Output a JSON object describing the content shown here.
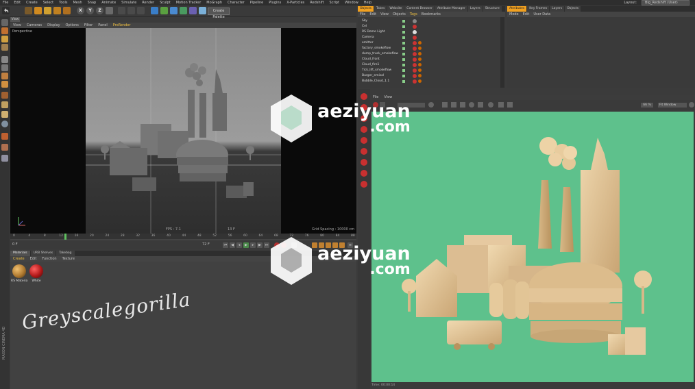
{
  "app": {
    "menu": [
      "File",
      "Edit",
      "Create",
      "Select",
      "Tools",
      "Mesh",
      "Snap",
      "Animate",
      "Simulate",
      "Render",
      "Sculpt",
      "Motion Tracker",
      "MoGraph",
      "Character",
      "Pipeline",
      "Plugins",
      "X-Particles",
      "Redshift",
      "Script",
      "Window",
      "Help"
    ],
    "layout_label": "Layout:",
    "layout_value": "Big_Redshift (User)"
  },
  "toolbar": {
    "axis_x": "X",
    "axis_y": "Y",
    "axis_z": "Z",
    "render_badge": "Create Palette"
  },
  "viewport": {
    "tab": "View",
    "menu": [
      "View",
      "Cameras",
      "Display",
      "Options",
      "Filter",
      "Panel",
      "ProRender"
    ],
    "active_menu": "ProRender",
    "label": "Perspective",
    "fps": "FPS : 7.1",
    "frame": "13 F",
    "grid_spacing": "Grid Spacing : 10000 cm"
  },
  "timeline": {
    "ticks": [
      "0",
      "4",
      "8",
      "12",
      "16",
      "20",
      "24",
      "28",
      "32",
      "36",
      "40",
      "44",
      "48",
      "52",
      "56",
      "60",
      "64",
      "68",
      "72",
      "76",
      "80",
      "84",
      "88"
    ],
    "current_frame": "13 F",
    "start": "0 F",
    "end": "72 F"
  },
  "materials": {
    "tabs": [
      "Materials",
      "URB Shelves",
      "Takebag"
    ],
    "menu": [
      "Create",
      "Edit",
      "Function",
      "Texture"
    ],
    "active_menu": "Create",
    "items": [
      {
        "name": "RS Materia",
        "color": "#c88a38"
      },
      {
        "name": "White",
        "color": "#b01818"
      }
    ]
  },
  "brand": {
    "logo_text": "Greyscalegorilla",
    "side_text": "MAXON CINEMA 4D"
  },
  "object_manager": {
    "tabs": [
      "Objects",
      "Takes",
      "Website",
      "Content Browser",
      "Attribute Manager",
      "Layers",
      "Structure"
    ],
    "menu": [
      "File",
      "Edit",
      "View",
      "Objects",
      "Tags",
      "Bookmarks"
    ],
    "active_menu": "Tags",
    "rows": [
      "Sky",
      "Cel",
      "RS Dome Light",
      "Camera",
      "emitter",
      "factory_smokeflow",
      "dump_truck_smokeflow",
      "Cloud_front",
      "Cloud_fire1",
      "Tick_lift_smokeflow",
      "Burger_emisal",
      "Bubble_Cloud_1.1"
    ]
  },
  "attribute_manager": {
    "tabs": [
      "Attributes",
      "Key Frames",
      "Layers",
      "Objects"
    ],
    "menu": [
      "Mode",
      "Edit",
      "User Data"
    ]
  },
  "render_view": {
    "menu": [
      "File",
      "View"
    ],
    "zoom": "66 %",
    "fit": "Fit Window",
    "status": "Time: 00:00:14",
    "background": "#5ec18c"
  },
  "watermark": {
    "brand": "aeziyuan",
    "domain": ".com"
  }
}
